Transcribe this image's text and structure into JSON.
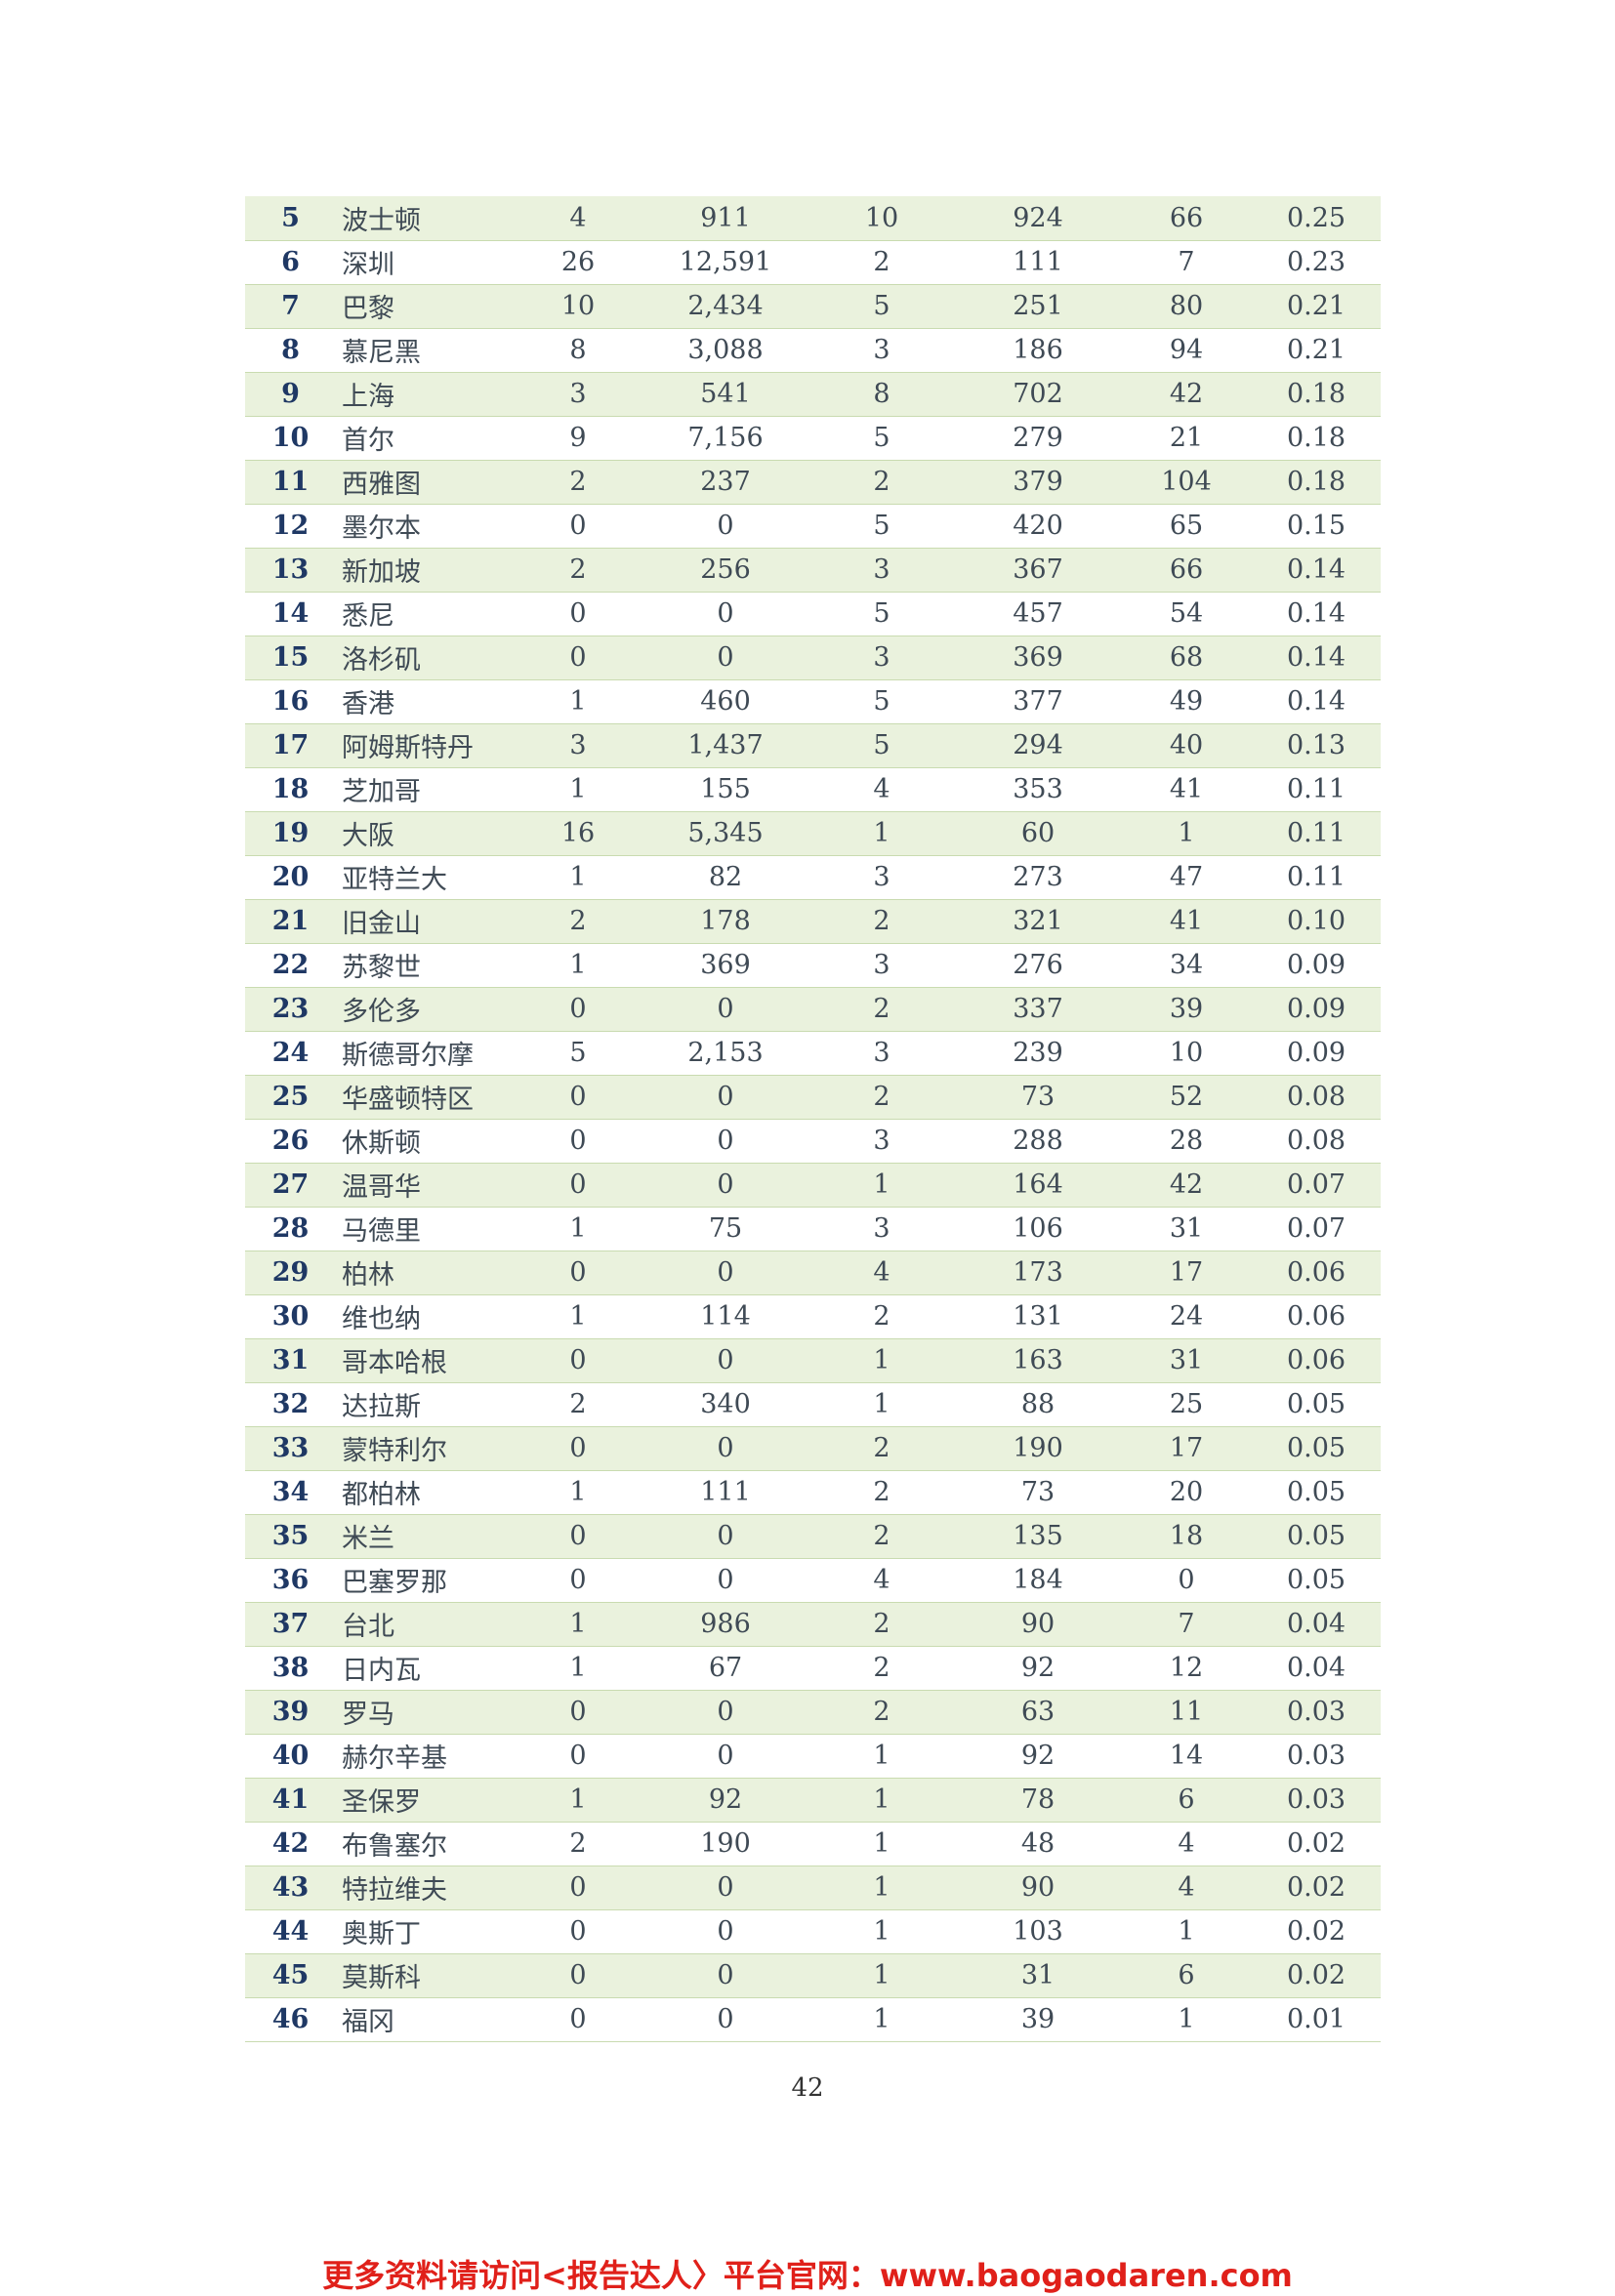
{
  "table": {
    "rows": [
      [
        "5",
        "波士顿",
        "4",
        "911",
        "10",
        "924",
        "66",
        "0.25"
      ],
      [
        "6",
        "深圳",
        "26",
        "12,591",
        "2",
        "111",
        "7",
        "0.23"
      ],
      [
        "7",
        "巴黎",
        "10",
        "2,434",
        "5",
        "251",
        "80",
        "0.21"
      ],
      [
        "8",
        "慕尼黑",
        "8",
        "3,088",
        "3",
        "186",
        "94",
        "0.21"
      ],
      [
        "9",
        "上海",
        "3",
        "541",
        "8",
        "702",
        "42",
        "0.18"
      ],
      [
        "10",
        "首尔",
        "9",
        "7,156",
        "5",
        "279",
        "21",
        "0.18"
      ],
      [
        "11",
        "西雅图",
        "2",
        "237",
        "2",
        "379",
        "104",
        "0.18"
      ],
      [
        "12",
        "墨尔本",
        "0",
        "0",
        "5",
        "420",
        "65",
        "0.15"
      ],
      [
        "13",
        "新加坡",
        "2",
        "256",
        "3",
        "367",
        "66",
        "0.14"
      ],
      [
        "14",
        "悉尼",
        "0",
        "0",
        "5",
        "457",
        "54",
        "0.14"
      ],
      [
        "15",
        "洛杉矶",
        "0",
        "0",
        "3",
        "369",
        "68",
        "0.14"
      ],
      [
        "16",
        "香港",
        "1",
        "460",
        "5",
        "377",
        "49",
        "0.14"
      ],
      [
        "17",
        "阿姆斯特丹",
        "3",
        "1,437",
        "5",
        "294",
        "40",
        "0.13"
      ],
      [
        "18",
        "芝加哥",
        "1",
        "155",
        "4",
        "353",
        "41",
        "0.11"
      ],
      [
        "19",
        "大阪",
        "16",
        "5,345",
        "1",
        "60",
        "1",
        "0.11"
      ],
      [
        "20",
        "亚特兰大",
        "1",
        "82",
        "3",
        "273",
        "47",
        "0.11"
      ],
      [
        "21",
        "旧金山",
        "2",
        "178",
        "2",
        "321",
        "41",
        "0.10"
      ],
      [
        "22",
        "苏黎世",
        "1",
        "369",
        "3",
        "276",
        "34",
        "0.09"
      ],
      [
        "23",
        "多伦多",
        "0",
        "0",
        "2",
        "337",
        "39",
        "0.09"
      ],
      [
        "24",
        "斯德哥尔摩",
        "5",
        "2,153",
        "3",
        "239",
        "10",
        "0.09"
      ],
      [
        "25",
        "华盛顿特区",
        "0",
        "0",
        "2",
        "73",
        "52",
        "0.08"
      ],
      [
        "26",
        "休斯顿",
        "0",
        "0",
        "3",
        "288",
        "28",
        "0.08"
      ],
      [
        "27",
        "温哥华",
        "0",
        "0",
        "1",
        "164",
        "42",
        "0.07"
      ],
      [
        "28",
        "马德里",
        "1",
        "75",
        "3",
        "106",
        "31",
        "0.07"
      ],
      [
        "29",
        "柏林",
        "0",
        "0",
        "4",
        "173",
        "17",
        "0.06"
      ],
      [
        "30",
        "维也纳",
        "1",
        "114",
        "2",
        "131",
        "24",
        "0.06"
      ],
      [
        "31",
        "哥本哈根",
        "0",
        "0",
        "1",
        "163",
        "31",
        "0.06"
      ],
      [
        "32",
        "达拉斯",
        "2",
        "340",
        "1",
        "88",
        "25",
        "0.05"
      ],
      [
        "33",
        "蒙特利尔",
        "0",
        "0",
        "2",
        "190",
        "17",
        "0.05"
      ],
      [
        "34",
        "都柏林",
        "1",
        "111",
        "2",
        "73",
        "20",
        "0.05"
      ],
      [
        "35",
        "米兰",
        "0",
        "0",
        "2",
        "135",
        "18",
        "0.05"
      ],
      [
        "36",
        "巴塞罗那",
        "0",
        "0",
        "4",
        "184",
        "0",
        "0.05"
      ],
      [
        "37",
        "台北",
        "1",
        "986",
        "2",
        "90",
        "7",
        "0.04"
      ],
      [
        "38",
        "日内瓦",
        "1",
        "67",
        "2",
        "92",
        "12",
        "0.04"
      ],
      [
        "39",
        "罗马",
        "0",
        "0",
        "2",
        "63",
        "11",
        "0.03"
      ],
      [
        "40",
        "赫尔辛基",
        "0",
        "0",
        "1",
        "92",
        "14",
        "0.03"
      ],
      [
        "41",
        "圣保罗",
        "1",
        "92",
        "1",
        "78",
        "6",
        "0.03"
      ],
      [
        "42",
        "布鲁塞尔",
        "2",
        "190",
        "1",
        "48",
        "4",
        "0.02"
      ],
      [
        "43",
        "特拉维夫",
        "0",
        "0",
        "1",
        "90",
        "4",
        "0.02"
      ],
      [
        "44",
        "奥斯丁",
        "0",
        "0",
        "1",
        "103",
        "1",
        "0.02"
      ],
      [
        "45",
        "莫斯科",
        "0",
        "0",
        "1",
        "31",
        "6",
        "0.02"
      ],
      [
        "46",
        "福冈",
        "0",
        "0",
        "1",
        "39",
        "1",
        "0.01"
      ]
    ]
  },
  "page_number": "42",
  "footer_note": "更多资料请访问<报告达人〉平台官网：www.baogaodaren.com"
}
